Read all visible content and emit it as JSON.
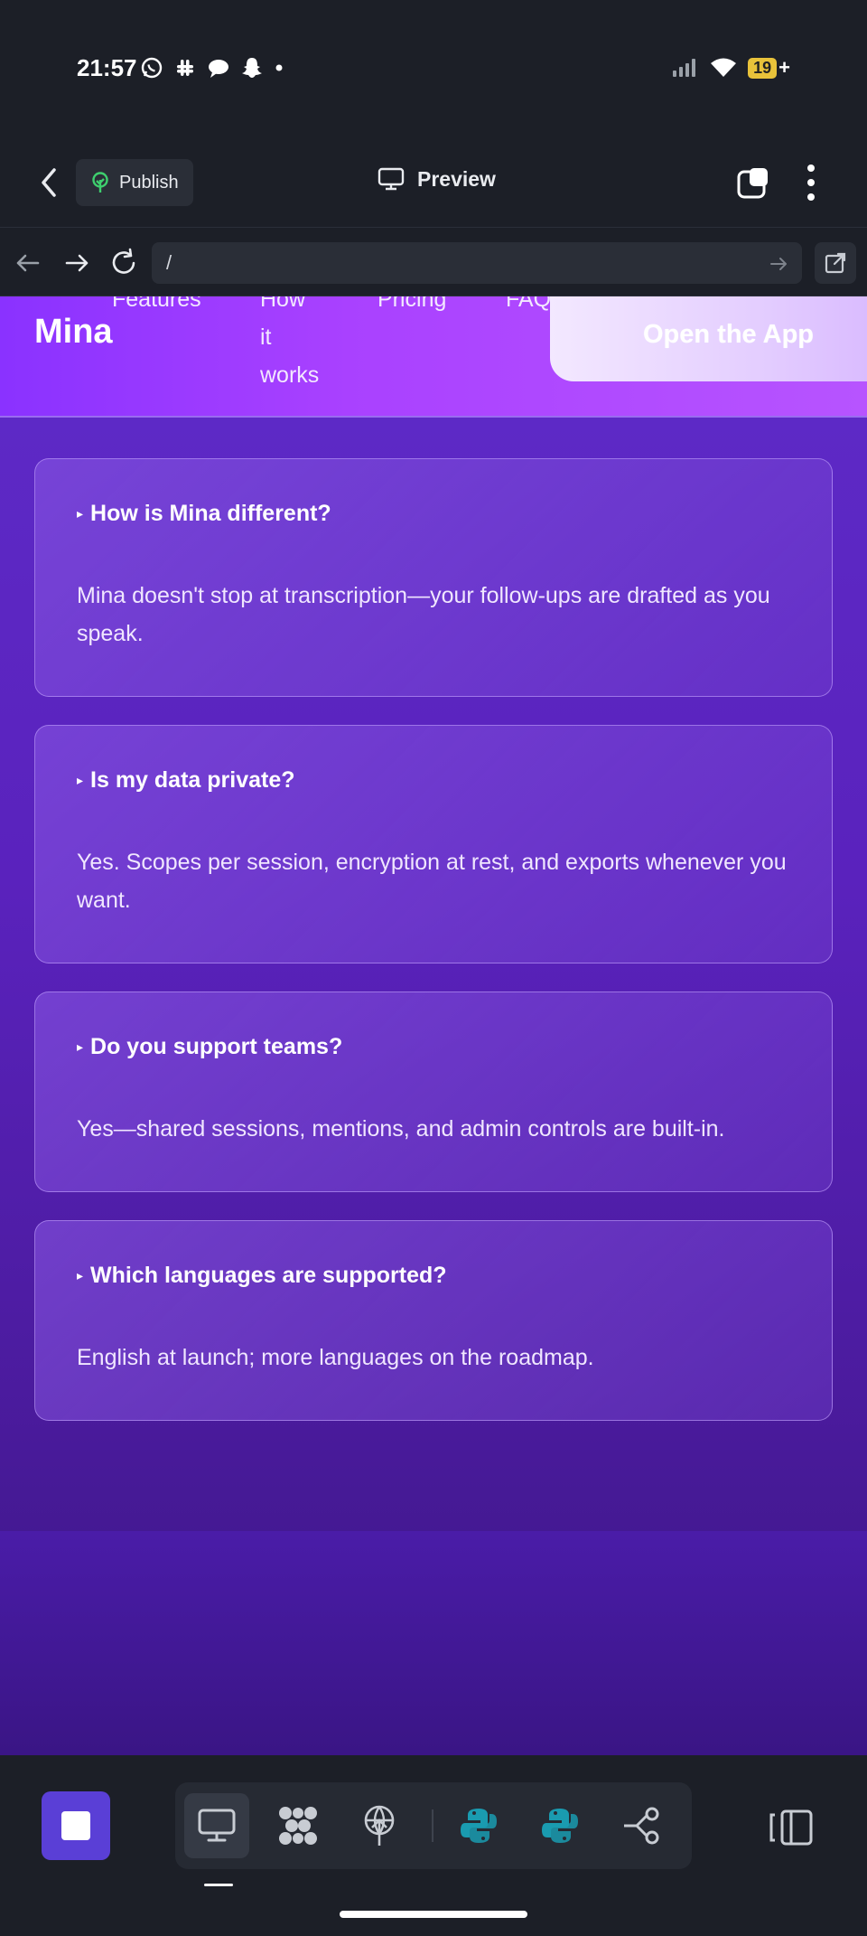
{
  "status_bar": {
    "time": "21:57",
    "battery": "19",
    "left_icons": [
      "whatsapp-icon",
      "slack-icon",
      "chat-icon",
      "snapchat-icon",
      "dot-icon"
    ],
    "right_icons": [
      "signal-icon",
      "wifi-icon",
      "battery-icon"
    ]
  },
  "toolbar": {
    "publish_label": "Publish",
    "preview_label": "Preview"
  },
  "urlbar": {
    "url": "/"
  },
  "site": {
    "brand": "Mina",
    "nav": [
      "Features",
      "How it works",
      "Pricing",
      "FAQ"
    ],
    "nav_how_lines": [
      "How",
      "it",
      "works"
    ],
    "cta": "Open the App",
    "faqs": [
      {
        "question": "How is Mina different?",
        "answer": "Mina doesn't stop at transcription—your follow-ups are drafted as you speak."
      },
      {
        "question": "Is my data private?",
        "answer": "Yes. Scopes per session, encryption at rest, and exports whenever you want."
      },
      {
        "question": "Do you support teams?",
        "answer": "Yes—shared sessions, mentions, and admin controls are built-in."
      },
      {
        "question": "Which languages are supported?",
        "answer": "English at launch; more languages on the roadmap."
      }
    ]
  },
  "dock": {
    "icons": [
      "stop-icon",
      "desktop-icon",
      "dotgrid-icon",
      "antenna-icon",
      "python-icon",
      "python-icon",
      "share-icon",
      "panel-icon"
    ]
  },
  "colors": {
    "accent": "#5a3fd6",
    "header_gradient_start": "#8a32ff",
    "header_gradient_end": "#b754ff",
    "python_teal": "#1a9bb0"
  }
}
